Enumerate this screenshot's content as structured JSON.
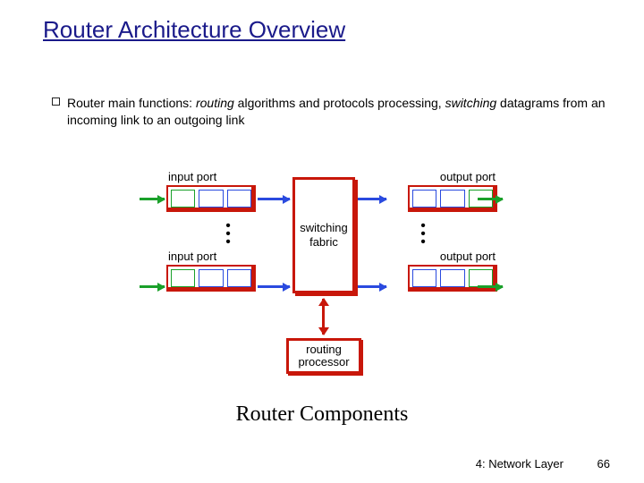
{
  "title": "Router Architecture Overview",
  "bullet": {
    "lead": "Router main functions: ",
    "italic1": "routing",
    "mid1": " algorithms and protocols processing, ",
    "italic2": "switching",
    "tail": " datagrams from an incoming link to an outgoing link"
  },
  "diagram": {
    "input_port_label": "input port",
    "output_port_label": "output port",
    "switching_line1": "switching",
    "switching_line2": "fabric",
    "routing_line1": "routing",
    "routing_line2": "processor"
  },
  "caption": "Router Components",
  "footer": {
    "section": "4: Network Layer",
    "page": "66"
  }
}
